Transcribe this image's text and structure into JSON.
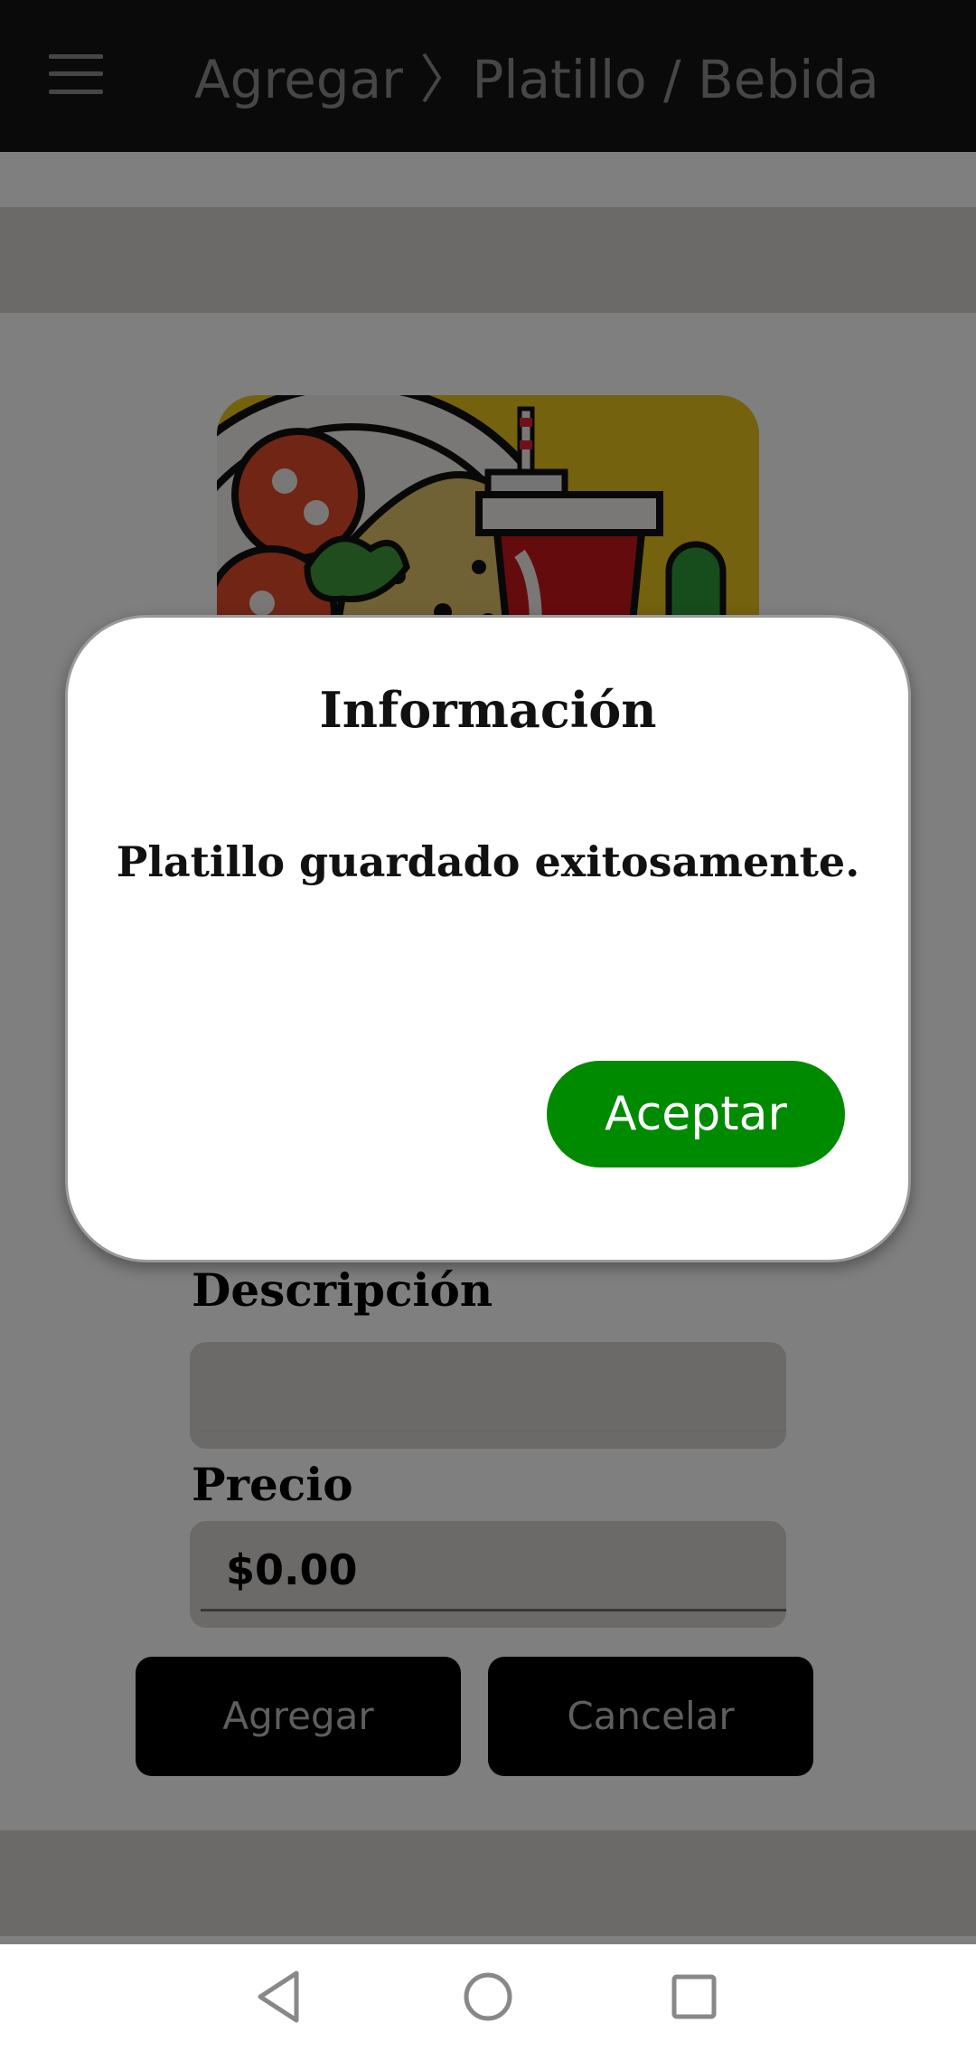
{
  "app_bar": {
    "title": "Agregar 〉Platillo / Bebida",
    "menu_icon": "hamburger-menu-icon"
  },
  "form": {
    "hero_image": "food-and-drink-illustration",
    "description_label": "Descripción",
    "description_value": "",
    "price_label": "Precio",
    "price_value": "$0.00",
    "add_button": "Agregar",
    "cancel_button": "Cancelar"
  },
  "dialog": {
    "title": "Información",
    "message": "Platillo guardado exitosamente.",
    "accept_button": "Aceptar",
    "accept_color": "#008a00"
  },
  "nav_bar": {
    "back_icon": "back-triangle-icon",
    "home_icon": "home-circle-icon",
    "recents_icon": "recents-square-icon"
  }
}
